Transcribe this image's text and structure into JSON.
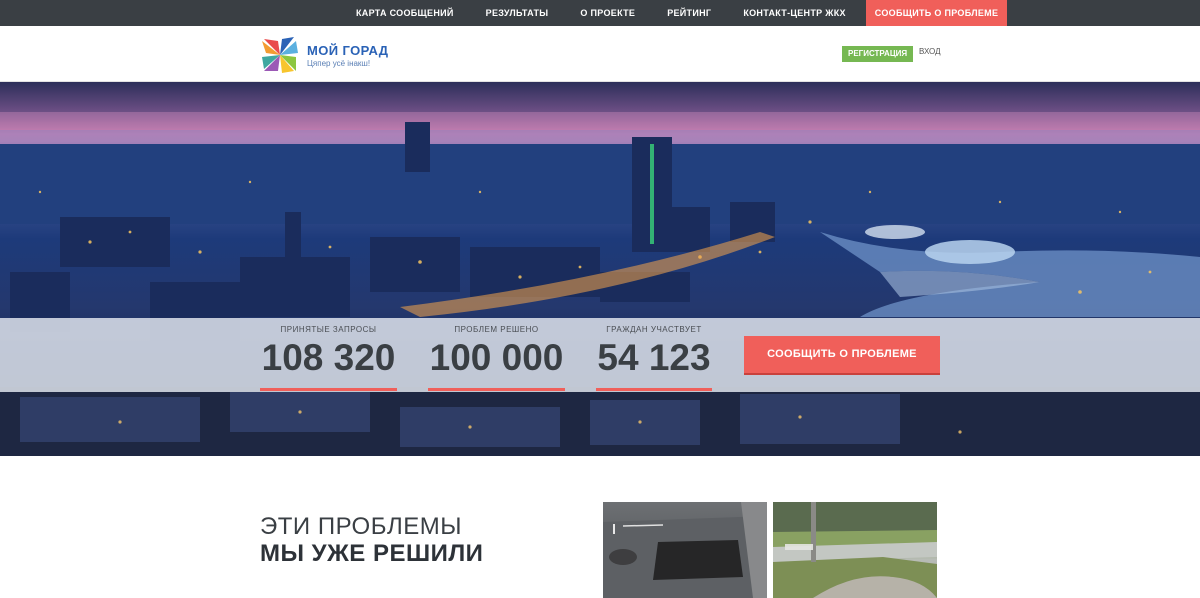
{
  "topnav": {
    "items": [
      "Карта сообщений",
      "Результаты",
      "О проекте",
      "Рейтинг",
      "Контакт-центр ЖКХ"
    ],
    "report": "Сообщить о проблеме"
  },
  "header": {
    "brand_name": "МОЙ ГОРАД",
    "tagline": "Цяпер усё інакш!",
    "register": "РЕГИСТРАЦИЯ",
    "login": "ВХОД"
  },
  "stats": [
    {
      "label": "Принятые запросы",
      "value": "108 320"
    },
    {
      "label": "Проблем решено",
      "value": "100 000"
    },
    {
      "label": "Граждан участвует",
      "value": "54 123"
    }
  ],
  "hero": {
    "report_button": "Сообщить о проблеме"
  },
  "solved": {
    "title_light": "ЭТИ ПРОБЛЕМЫ",
    "title_bold": "МЫ УЖЕ РЕШИЛИ"
  },
  "colors": {
    "nav_bg": "#3a3f44",
    "accent": "#f05f5a",
    "register_green": "#76b852",
    "brand_blue": "#2a62b6"
  }
}
